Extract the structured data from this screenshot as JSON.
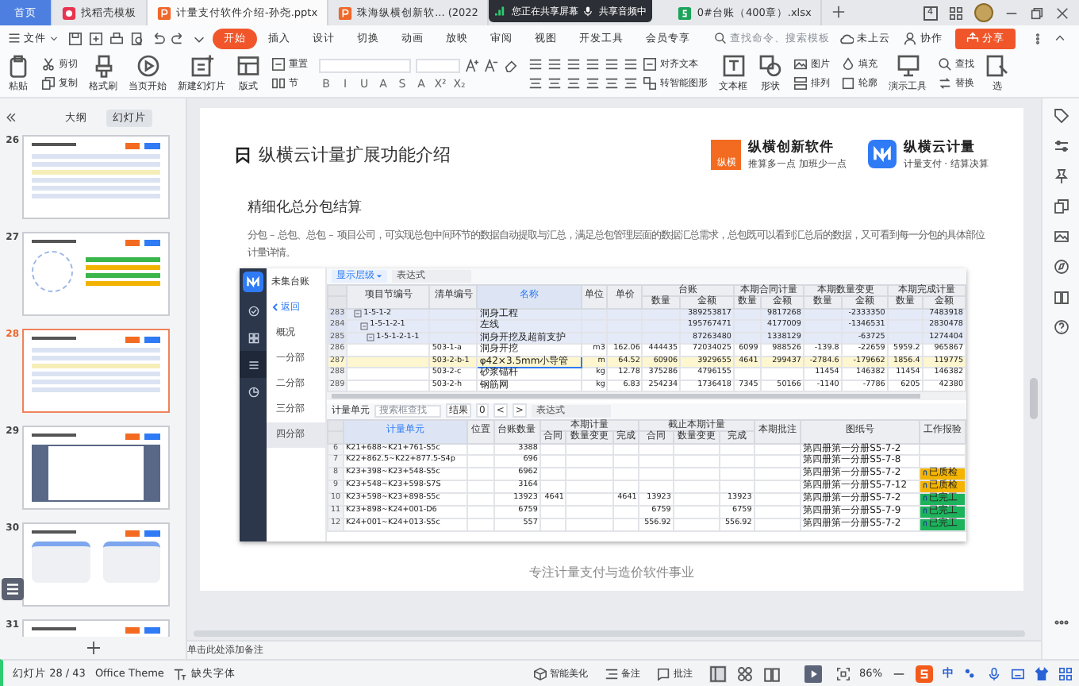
{
  "title_bar": {
    "tabs": [
      {
        "kind": "home",
        "label": "首页",
        "selected": false
      },
      {
        "kind": "template",
        "label": "找稻壳模板",
        "selected": false
      },
      {
        "kind": "ppt",
        "label": "计量支付软件介绍-孙尧.pptx",
        "selected": true
      },
      {
        "kind": "ppt",
        "label": "珠海纵横创新软... (2022",
        "selected": false
      },
      {
        "kind": "xls",
        "label": "0#台账（400章）.xlsx",
        "selected": false
      }
    ],
    "sharing": [
      "您正在共享屏幕",
      "共享音频中"
    ],
    "window_count": "4"
  },
  "menu_bar": {
    "file": "文件",
    "tabs": [
      {
        "label": "开始",
        "selected": true
      },
      {
        "label": "插入",
        "selected": false
      },
      {
        "label": "设计",
        "selected": false
      },
      {
        "label": "切换",
        "selected": false
      },
      {
        "label": "动画",
        "selected": false
      },
      {
        "label": "放映",
        "selected": false
      },
      {
        "label": "审阅",
        "selected": false
      },
      {
        "label": "视图",
        "selected": false
      },
      {
        "label": "开发工具",
        "selected": false
      },
      {
        "label": "会员专享",
        "selected": false
      }
    ],
    "search": {
      "placeholder": "查找命令、搜索模板"
    },
    "cloud": "未上云",
    "collab": "协作",
    "share": "分享"
  },
  "ribbon": [
    {
      "kind": "large",
      "label": "粘贴"
    },
    {
      "kind": "pair",
      "labels": [
        "剪切",
        "复制"
      ]
    },
    {
      "kind": "large",
      "label": "格式刷"
    },
    {
      "kind": "large",
      "label": "当页开始"
    },
    {
      "kind": "large",
      "label": "新建幻灯片"
    },
    {
      "kind": "large",
      "label": "版式"
    },
    {
      "kind": "pair",
      "labels": [
        "重置",
        "节"
      ]
    },
    {
      "kind": "font",
      "glyphs": [
        "B",
        "I",
        "U",
        "A",
        "S",
        "A",
        "X²",
        "X₂"
      ]
    },
    {
      "kind": "para",
      "labels": [
        "对齐文本",
        "转智能图形"
      ]
    },
    {
      "kind": "large",
      "label": "文本框"
    },
    {
      "kind": "large",
      "label": "形状"
    },
    {
      "kind": "pair",
      "labels": [
        "图片",
        "排列"
      ]
    },
    {
      "kind": "pair",
      "labels": [
        "填充",
        "轮廓"
      ]
    },
    {
      "kind": "large",
      "label": "演示工具"
    },
    {
      "kind": "pair",
      "labels": [
        "查找",
        "替换"
      ]
    },
    {
      "kind": "large",
      "label": "选"
    }
  ],
  "outline_panel": {
    "tabs": [
      {
        "label": "大纲",
        "selected": false
      },
      {
        "label": "幻灯片",
        "selected": true
      }
    ],
    "slides": [
      {
        "number": "26",
        "kind": "table",
        "selected": false
      },
      {
        "number": "27",
        "kind": "diagram",
        "selected": false
      },
      {
        "number": "28",
        "kind": "table",
        "selected": true
      },
      {
        "number": "29",
        "kind": "dashboard",
        "selected": false
      },
      {
        "number": "30",
        "kind": "cards",
        "selected": false
      },
      {
        "number": "31",
        "kind": "blank",
        "selected": false
      }
    ]
  },
  "slide": {
    "title": "纵横云计量扩展功能介绍",
    "logos": [
      {
        "kind": "square",
        "mark": "纵横",
        "name": "纵横创新软件",
        "tagline": "推算多一点  加班少一点"
      },
      {
        "kind": "app",
        "name": "纵横云计量",
        "tagline": "计量支付 · 结算决算"
      }
    ],
    "heading": "精细化总分包结算",
    "body": "分包 – 总包、总包 – 项目公司，可实现总包中间环节的数据自动提取与汇总，满足总包管理层面的数据汇总需求，总包既可以看到汇总后的数据，又可看到每一分包的具体部位计量详情。",
    "screenshot": {
      "nav": [
        {
          "selected": false
        },
        {
          "selected": false
        },
        {
          "selected": true
        },
        {
          "selected": false
        }
      ],
      "side_title": "未集台账",
      "back": "返回",
      "sections": [
        {
          "label": "概况",
          "selected": false
        },
        {
          "label": "一分部",
          "selected": false
        },
        {
          "label": "二分部",
          "selected": false
        },
        {
          "label": "三分部",
          "selected": false
        },
        {
          "label": "四分部",
          "selected": true
        }
      ],
      "upper": {
        "level_button": "显示层级",
        "expression": "表达式",
        "columns": [
          "项目节编号",
          "清单编号",
          "名称",
          "单位",
          "单价"
        ],
        "column_groups": [
          {
            "label": "台账",
            "columns": [
              "数量",
              "金额"
            ]
          },
          {
            "label": "本期合同计量",
            "columns": [
              "数量",
              "金额"
            ]
          },
          {
            "label": "本期数量变更",
            "columns": [
              "数量",
              "金额"
            ]
          },
          {
            "label": "本期完成计量",
            "columns": [
              "数量",
              "金额"
            ]
          }
        ],
        "rows": [
          {
            "index": "283",
            "expanded": true,
            "selected": false,
            "cells": [
              "1-5-1-2",
              null,
              "洞身工程",
              null,
              null,
              null,
              "389253817",
              null,
              "9817268",
              null,
              "-2333350",
              null,
              "7483918"
            ],
            "children": [
              {
                "index": "284",
                "expanded": true,
                "selected": false,
                "cells": [
                  "1-5-1-2-1",
                  null,
                  "左线",
                  null,
                  null,
                  null,
                  "195767471",
                  null,
                  "4177009",
                  null,
                  "-1346531",
                  null,
                  "2830478"
                ],
                "children": [
                  {
                    "index": "285",
                    "expanded": true,
                    "selected": false,
                    "cells": [
                      "1-5-1-2-1-1",
                      null,
                      "洞身开挖及超前支护",
                      null,
                      null,
                      null,
                      "87263480",
                      null,
                      "1338129",
                      null,
                      "-63725",
                      null,
                      "1274404"
                    ],
                    "children": [
                      {
                        "index": "286",
                        "selected": false,
                        "cells": [
                          null,
                          "503-1-a",
                          "洞身开挖",
                          "m3",
                          "162.06",
                          "444435",
                          "72034025",
                          "6099",
                          "988526",
                          "-139.8",
                          "-22659",
                          "5959.2",
                          "965867"
                        ]
                      },
                      {
                        "index": "287",
                        "selected": true,
                        "cells": [
                          null,
                          "503-2-b-1",
                          "φ42×3.5mm小导管",
                          "m",
                          "64.52",
                          "60906",
                          "3929655",
                          "4641",
                          "299437",
                          "-2784.6",
                          "-179662",
                          "1856.4",
                          "119775"
                        ]
                      },
                      {
                        "index": "288",
                        "selected": false,
                        "cells": [
                          null,
                          "503-2-c",
                          "砂浆锚杆",
                          "kg",
                          "12.78",
                          "375286",
                          "4796155",
                          null,
                          null,
                          "11454",
                          "146382",
                          "11454",
                          "146382"
                        ]
                      },
                      {
                        "index": "289",
                        "selected": false,
                        "cells": [
                          null,
                          "503-2-h",
                          "钢筋网",
                          "kg",
                          "6.83",
                          "254234",
                          "1736418",
                          "7345",
                          "50166",
                          "-1140",
                          "-7786",
                          "6205",
                          "42380"
                        ]
                      }
                    ]
                  }
                ]
              }
            ]
          }
        ]
      },
      "lower": {
        "label": "计量单元",
        "search": {
          "placeholder": "搜索框查找"
        },
        "result_label": "结果",
        "result_count": "0",
        "prev": "<",
        "next": ">",
        "expression": "表达式",
        "columns": [
          "计量单元",
          "位置",
          "台账数量"
        ],
        "column_groups": [
          {
            "label": "本期计量",
            "columns": [
              "合同",
              "数量变更",
              "完成"
            ]
          },
          {
            "label": "截止本期计量",
            "columns": [
              "合同",
              "数量变更",
              "完成"
            ]
          }
        ],
        "tail_columns": [
          "本期批注",
          "图纸号",
          "工作报验"
        ],
        "rows": [
          {
            "index": "6",
            "cells": [
              "K21+688~K21+761-S5c",
              null,
              "3388",
              null,
              null,
              null,
              null,
              null,
              null,
              null,
              "第四册第一分册S5-7-2"
            ]
          },
          {
            "index": "7",
            "cells": [
              "K22+862.5~K22+877.5-S4p",
              null,
              "696",
              null,
              null,
              null,
              null,
              null,
              null,
              null,
              "第四册第一分册S5-7-8"
            ]
          },
          {
            "index": "8",
            "cells": [
              "K23+398~K23+548-S5c",
              null,
              "6962",
              null,
              null,
              null,
              null,
              null,
              null,
              null,
              "第四册第一分册S5-7-2"
            ],
            "status": {
              "label": "已质检",
              "color": "#f4b400"
            }
          },
          {
            "index": "9",
            "cells": [
              "K23+548~K23+598-S7S",
              null,
              "3164",
              null,
              null,
              null,
              null,
              null,
              null,
              null,
              "第四册第一分册S5-7-12"
            ],
            "status": {
              "label": "已质检",
              "color": "#f4b400"
            }
          },
          {
            "index": "10",
            "cells": [
              "K23+598~K23+898-S5c",
              null,
              "13923",
              "4641",
              null,
              "4641",
              "13923",
              null,
              "13923",
              null,
              "第四册第一分册S5-7-2"
            ],
            "status": {
              "label": "已完工",
              "color": "#1db35c"
            }
          },
          {
            "index": "11",
            "cells": [
              "K23+898~K24+001-D6",
              null,
              "6759",
              null,
              null,
              null,
              "6759",
              null,
              "6759",
              null,
              "第四册第一分册S5-7-9"
            ],
            "status": {
              "label": "已完工",
              "color": "#1db35c"
            }
          },
          {
            "index": "12",
            "cells": [
              "K24+001~K24+013-S5c",
              null,
              "557",
              null,
              null,
              null,
              "556.92",
              null,
              "556.92",
              null,
              "第四册第一分册S5-7-2"
            ],
            "status": {
              "label": "已完工",
              "color": "#1db35c"
            }
          }
        ]
      }
    },
    "footer": "专注计量支付与造价软件事业"
  },
  "notes_placeholder": "单击此处添加备注",
  "status_bar": {
    "slide_counter": "幻灯片 28 / 43",
    "theme": "Office Theme",
    "missing_fonts": "缺失字体",
    "beautify": "智能美化",
    "notes": "备注",
    "comments": "批注",
    "views": [
      {
        "selected": true
      },
      {
        "selected": false
      },
      {
        "selected": false
      }
    ],
    "zoom": "86%",
    "ime": "中"
  }
}
